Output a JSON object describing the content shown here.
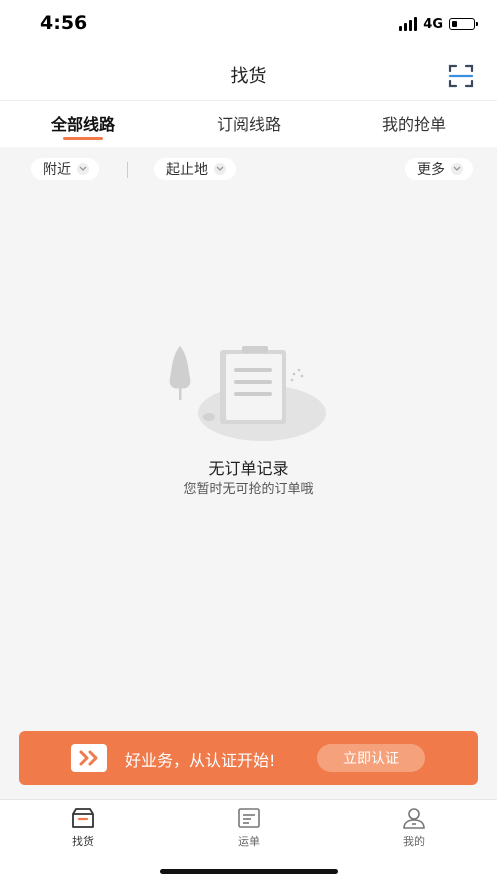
{
  "status_bar": {
    "time": "4:56",
    "network": "4G",
    "battery_level": 0.2,
    "signal_bars": 4
  },
  "nav": {
    "title": "找货",
    "scan_icon": "scan-icon"
  },
  "tabs": [
    {
      "label": "全部线路",
      "active": true
    },
    {
      "label": "订阅线路",
      "active": false
    },
    {
      "label": "我的抢单",
      "active": false
    }
  ],
  "filters": {
    "nearby": "附近",
    "route": "起止地",
    "more": "更多"
  },
  "empty_state": {
    "title": "无订单记录",
    "subtitle": "您暂时无可抢的订单哦",
    "icon": "empty-clipboard-icon"
  },
  "banner": {
    "text": "好业务，从认证开始!",
    "button": "立即认证",
    "icon": "double-chevron-icon"
  },
  "tab_bar": [
    {
      "label": "找货",
      "icon": "box-icon",
      "active": true
    },
    {
      "label": "运单",
      "icon": "waybill-icon",
      "active": false
    },
    {
      "label": "我的",
      "icon": "user-icon",
      "active": false
    }
  ],
  "colors": {
    "accent": "#f07a4a",
    "background": "#f5f5f5"
  }
}
